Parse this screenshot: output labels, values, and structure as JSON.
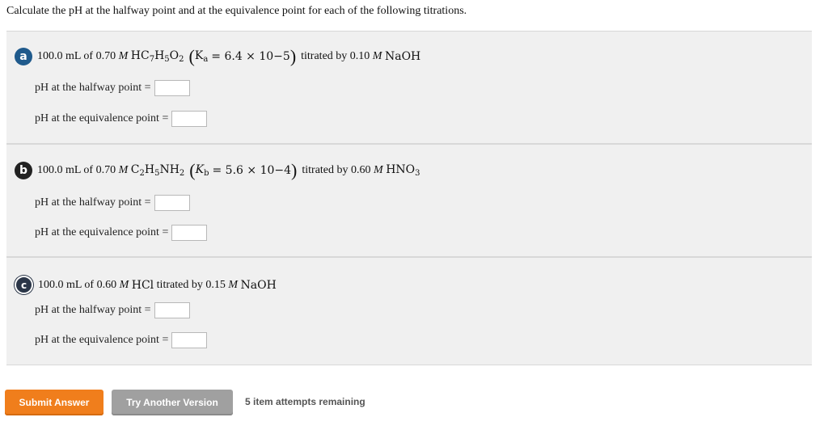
{
  "question": "Calculate the pH at the halfway point and at the equivalence point for each of the following titrations.",
  "parts": [
    {
      "badge": "a",
      "amount": "100.0 mL of 0.70",
      "molar": "M",
      "formula_html": "HC<sub>7</sub>H<sub>5</sub>O<sub>2</sub>",
      "k_symbol_html": "K<sub>a</sub>",
      "k_value": "= 6.4 × 10",
      "k_exp": "−5",
      "titrant_text": "titrated by 0.10",
      "titrant_molar": "M",
      "titrant": "NaOH",
      "halfway_label": "pH at the halfway point =",
      "equivalence_label": "pH at the equivalence point =",
      "halfway_value": "",
      "equivalence_value": ""
    },
    {
      "badge": "b",
      "amount": "100.0 mL of 0.70",
      "molar": "M",
      "formula_html": "C<sub>2</sub>H<sub>5</sub>NH<sub>2</sub>",
      "k_symbol_html": "<i class=\"var\">K</i><sub>b</sub>",
      "k_value": "= 5.6 × 10",
      "k_exp": "−4",
      "titrant_text": "titrated by 0.60",
      "titrant_molar": "M",
      "titrant_html": "HNO<sub>3</sub>",
      "halfway_label": "pH at the halfway point =",
      "equivalence_label": "pH at the equivalence point =",
      "halfway_value": "",
      "equivalence_value": ""
    },
    {
      "badge": "c",
      "amount": "100.0 mL of 0.60",
      "molar": "M",
      "formula": "HCl",
      "titrant_text": "titrated by 0.15",
      "titrant_molar": "M",
      "titrant": "NaOH",
      "halfway_label": "pH at the halfway point =",
      "equivalence_label": "pH at the equivalence point =",
      "halfway_value": "",
      "equivalence_value": ""
    }
  ],
  "buttons": {
    "submit": "Submit Answer",
    "try_another": "Try Another Version"
  },
  "attempts": "5 item attempts remaining",
  "colors": {
    "submit": "#f07e1c",
    "try_another": "#a0a0a0",
    "badge_a": "#1f5a8c",
    "badge_b": "#222222",
    "badge_c": "#2b3648",
    "panel_bg": "#f0f0f0"
  }
}
